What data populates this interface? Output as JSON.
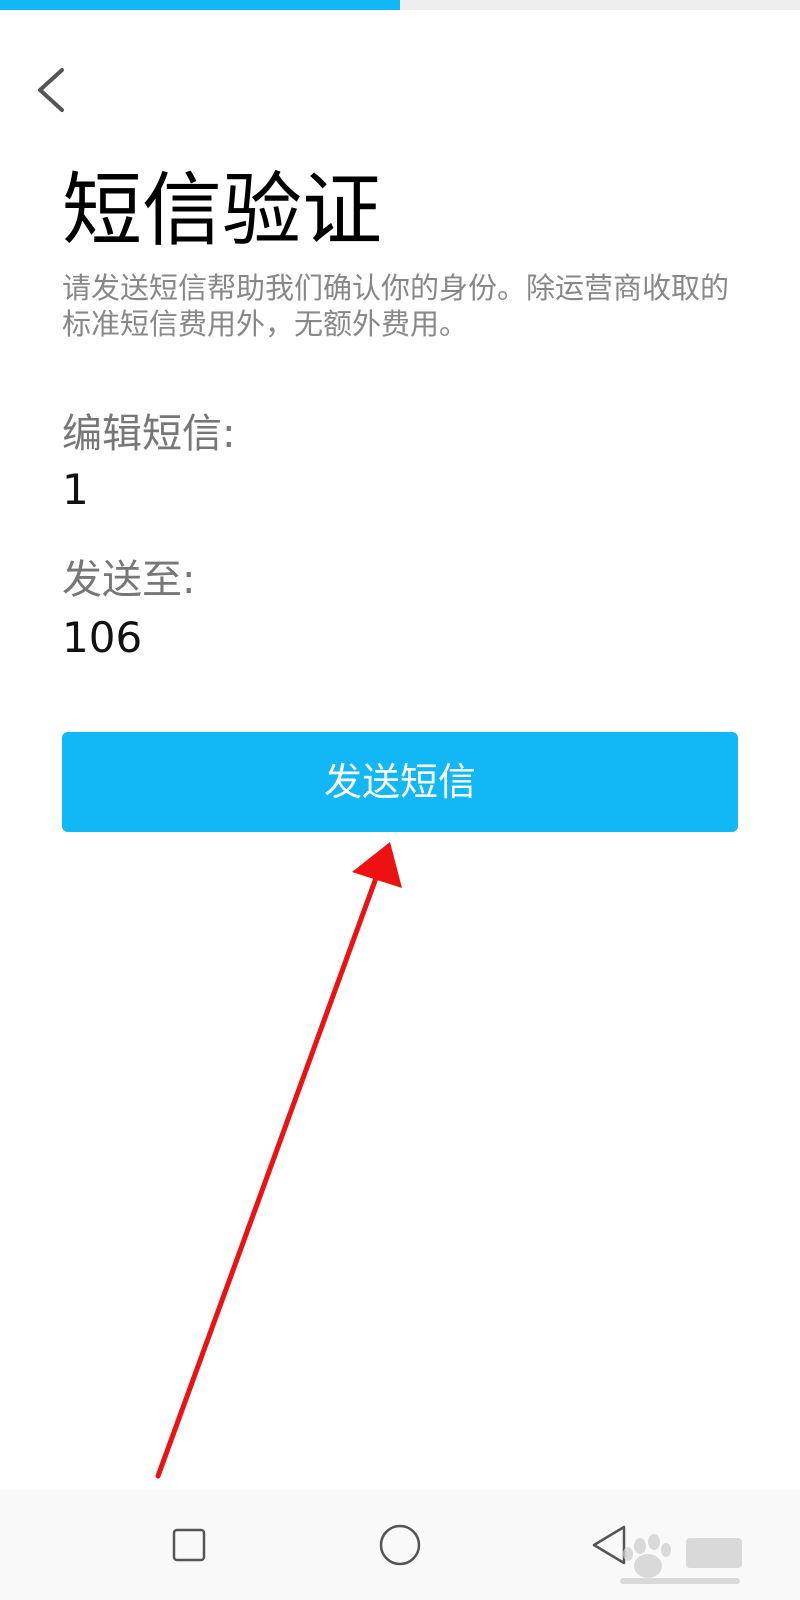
{
  "progress": {
    "fraction": 0.5
  },
  "header": {
    "back_icon": "chevron-left-icon"
  },
  "main": {
    "title": "短信验证",
    "description": "请发送短信帮助我们确认你的身份。除运营商收取的标准短信费用外，无额外费用。",
    "sms_content_label": "编辑短信:",
    "sms_content_value": "1",
    "send_to_label": "发送至:",
    "send_to_value": "106",
    "send_button_label": "发送短信"
  },
  "annotation": {
    "arrow_color": "#ee1111"
  },
  "nav_bar": {
    "items": [
      "recent-apps-icon",
      "home-icon",
      "back-triangle-icon"
    ]
  },
  "colors": {
    "accent": "#12b7f5",
    "title_text": "#000000",
    "secondary_text": "#888888"
  }
}
